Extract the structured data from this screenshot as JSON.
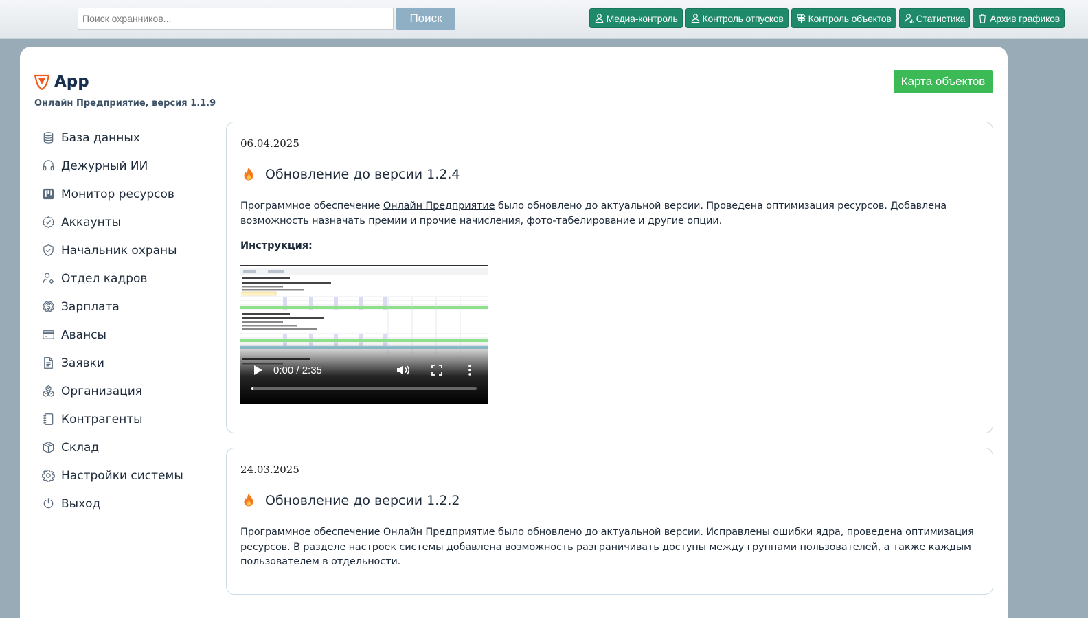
{
  "search": {
    "placeholder": "Поиск охранников...",
    "button_label": "Поиск"
  },
  "top_nav": [
    {
      "label": "Медиа-контроль",
      "icon": "user-icon"
    },
    {
      "label": "Контроль отпусков",
      "icon": "user-icon"
    },
    {
      "label": "Контроль объектов",
      "icon": "signpost-icon"
    },
    {
      "label": "Статистика",
      "icon": "user-chart-icon"
    },
    {
      "label": "Архив графиков",
      "icon": "trash-icon"
    }
  ],
  "brand": {
    "name": "App",
    "version": "Онлайн Предприятие, версия 1.1.9"
  },
  "map_button": "Карта объектов",
  "sidebar": {
    "items": [
      {
        "label": "База данных",
        "icon": "database-icon"
      },
      {
        "label": "Дежурный ИИ",
        "icon": "headset-icon"
      },
      {
        "label": "Монитор ресурсов",
        "icon": "kanban-icon"
      },
      {
        "label": "Аккаунты",
        "icon": "check-badge-icon"
      },
      {
        "label": "Начальник охраны",
        "icon": "shield-check-icon"
      },
      {
        "label": "Отдел кадров",
        "icon": "user-gear-icon"
      },
      {
        "label": "Зарплата",
        "icon": "coin-icon"
      },
      {
        "label": "Авансы",
        "icon": "credit-card-icon"
      },
      {
        "label": "Заявки",
        "icon": "document-icon"
      },
      {
        "label": "Организация",
        "icon": "boxes-icon"
      },
      {
        "label": "Контрагенты",
        "icon": "journal-icon"
      },
      {
        "label": "Склад",
        "icon": "box-icon"
      },
      {
        "label": "Настройки системы",
        "icon": "gear-icon"
      },
      {
        "label": "Выход",
        "icon": "power-icon"
      }
    ]
  },
  "news": [
    {
      "date": "06.04.2025",
      "title": "Обновление до версии 1.2.4",
      "text_before": "Программное обеспечение ",
      "link": "Онлайн Предприятие",
      "text_after": " было обновлено до актуальной версии. Проведена оптимизация ресурсов. Добавлена возможность назначать премии и прочие начисления, фото-табелирование и другие опции.",
      "instruction": "Инструкция:",
      "video": {
        "time": "0:00 / 2:35",
        "progress": 0.0
      }
    },
    {
      "date": "24.03.2025",
      "title": "Обновление до версии 1.2.2",
      "text_before": "Программное обеспечение ",
      "link": "Онлайн Предприятие",
      "text_after": " было обновлено до актуальной версии. Исправлены ошибки ядра, проведена оптимизация ресурсов. В разделе настроек системы добавлена возможность разграничивать доступы между группами пользователей, а также каждым пользователем в отдельности."
    }
  ],
  "colors": {
    "accent_green": "#1f8a6a",
    "map_button_green": "#3cba55",
    "search_button": "#8fafc4",
    "background": "#9aabb8",
    "fire_orange": "#f47a1f"
  }
}
